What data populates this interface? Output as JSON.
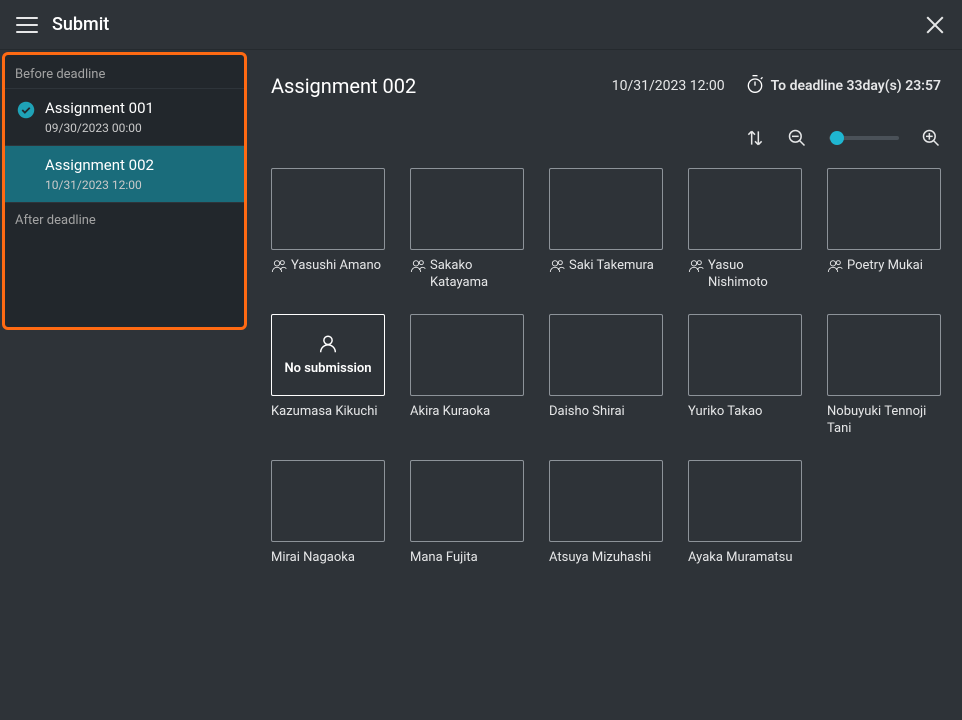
{
  "header": {
    "title": "Submit"
  },
  "sidebar": {
    "before_label": "Before deadline",
    "after_label": "After deadline",
    "assignments": [
      {
        "name": "Assignment 001",
        "date": "09/30/2023 00:00",
        "completed": true,
        "selected": false
      },
      {
        "name": "Assignment 002",
        "date": "10/31/2023 12:00",
        "completed": false,
        "selected": true
      }
    ]
  },
  "main": {
    "assignment_title": "Assignment 002",
    "deadline_datetime": "10/31/2023 12:00",
    "countdown_label": "To deadline 33day(s) 23:57"
  },
  "students": [
    {
      "name": "Yasushi Amano",
      "has_icon": true,
      "no_submission": false
    },
    {
      "name": "Sakako Katayama",
      "has_icon": true,
      "no_submission": false
    },
    {
      "name": "Saki Takemura",
      "has_icon": true,
      "no_submission": false
    },
    {
      "name": "Yasuo Nishimoto",
      "has_icon": true,
      "no_submission": false
    },
    {
      "name": "Poetry Mukai",
      "has_icon": true,
      "no_submission": false
    },
    {
      "name": "Kazumasa Kikuchi",
      "has_icon": false,
      "no_submission": true,
      "no_sub_text": "No submission"
    },
    {
      "name": "Akira Kuraoka",
      "has_icon": false,
      "no_submission": false
    },
    {
      "name": "Daisho Shirai",
      "has_icon": false,
      "no_submission": false
    },
    {
      "name": "Yuriko Takao",
      "has_icon": false,
      "no_submission": false
    },
    {
      "name": "Nobuyuki Tennoji Tani",
      "has_icon": false,
      "no_submission": false
    },
    {
      "name": "Mirai Nagaoka",
      "has_icon": false,
      "no_submission": false
    },
    {
      "name": "Mana Fujita",
      "has_icon": false,
      "no_submission": false
    },
    {
      "name": "Atsuya Mizuhashi",
      "has_icon": false,
      "no_submission": false
    },
    {
      "name": "Ayaka Muramatsu",
      "has_icon": false,
      "no_submission": false
    }
  ]
}
